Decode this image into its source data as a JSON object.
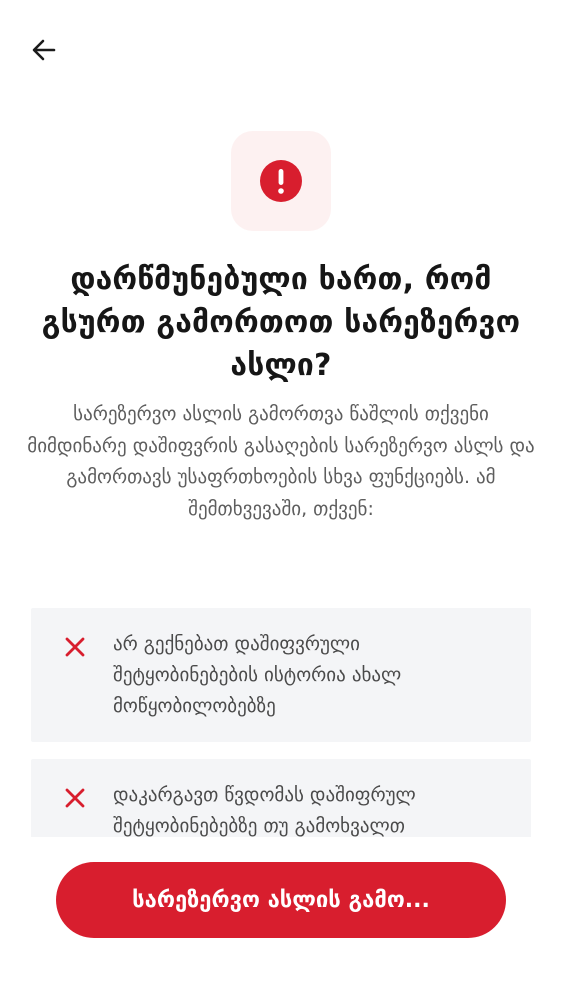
{
  "header": {
    "back_icon": "arrow-left-icon"
  },
  "hero": {
    "icon": "exclamation-circle-icon",
    "accent_color": "#d81e2e",
    "background_color": "#fdf1f1"
  },
  "title": "დარწმუნებული ხართ, რომ გსურთ გამორთოთ სარეზერვო ასლი?",
  "description": "სარეზერვო ასლის გამორთვა წაშლის თქვენი მიმდინარე დაშიფვრის გასაღების სარეზერვო ასლს და გამორთავს უსაფრთხოების სხვა ფუნქციებს. ამ შემთხვევაში, თქვენ:",
  "consequences": [
    {
      "icon": "close-icon",
      "text": "არ გექნებათ დაშიფვრული შეტყობინებების ისტორია ახალ მოწყობილობებზე"
    },
    {
      "icon": "close-icon",
      "text": "დაკარგავთ წვდომას დაშიფრულ შეტყობინებებზე თუ გამოხვალთ"
    }
  ],
  "actions": {
    "confirm_label": "სარეზერვო ასლის გამო...",
    "confirm_color": "#d81e2e"
  }
}
